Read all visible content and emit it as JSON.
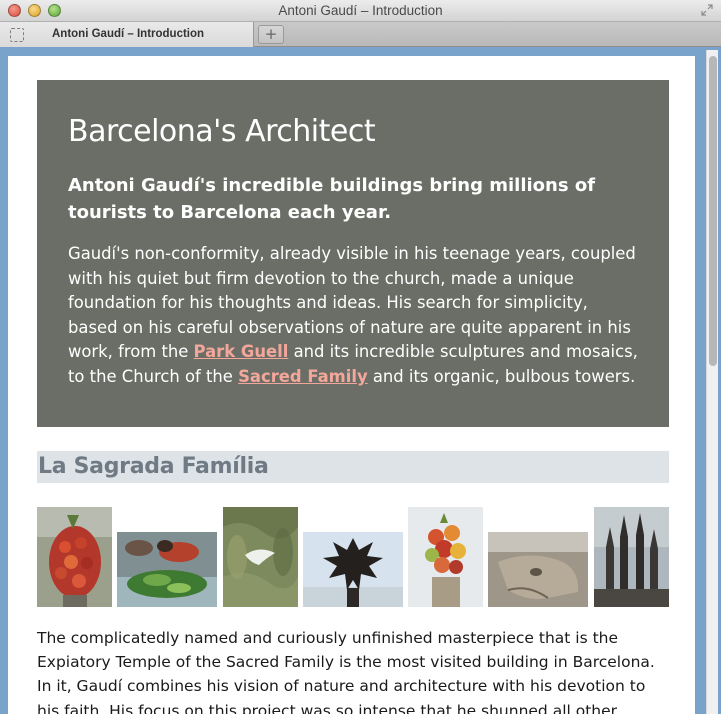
{
  "window": {
    "title": "Antoni Gaudí – Introduction",
    "tab_label": "Antoni Gaudí – Introduction",
    "new_tab_label": "+"
  },
  "page": {
    "hero": {
      "title": "Barcelona's Architect",
      "lead": "Antoni Gaudí's incredible buildings bring millions of tourists to Barcelona each year.",
      "body_before_link1": "Gaudí's non-conformity, already visible in his teenage years, coupled with his quiet but firm devotion to the church, made a unique foundation for his thoughts and ideas. His search for simplicity, based on his careful observations of nature are quite apparent in his work, from the ",
      "link1": "Park Guell",
      "body_between": " and its incredible sculptures and mosaics, to the Church of the ",
      "link2": "Sacred Family",
      "body_after": " and its organic, bulbous towers."
    },
    "section_title": "La Sagrada Família",
    "gallery": [
      "fruit-sculpture-photo",
      "chameleon-sculpture-photo",
      "dove-relief-photo",
      "spiky-finial-photo",
      "fruit-basket-pinnacle-photo",
      "stone-head-photo",
      "towers-photo"
    ],
    "article_text": "The complicatedly named and curiously unfinished masterpiece that is the Expiatory Temple of the Sacred Family is the most visited building in Barcelona. In it, Gaudí combines his vision of nature and architecture with his devotion to his faith. His focus on this project was so intense that he shunned all other projects, slept in an"
  },
  "colors": {
    "hero_bg": "#6b6e66",
    "link": "#f3a79b",
    "section_bg": "#dde3e6",
    "section_text": "#6f7a84"
  }
}
